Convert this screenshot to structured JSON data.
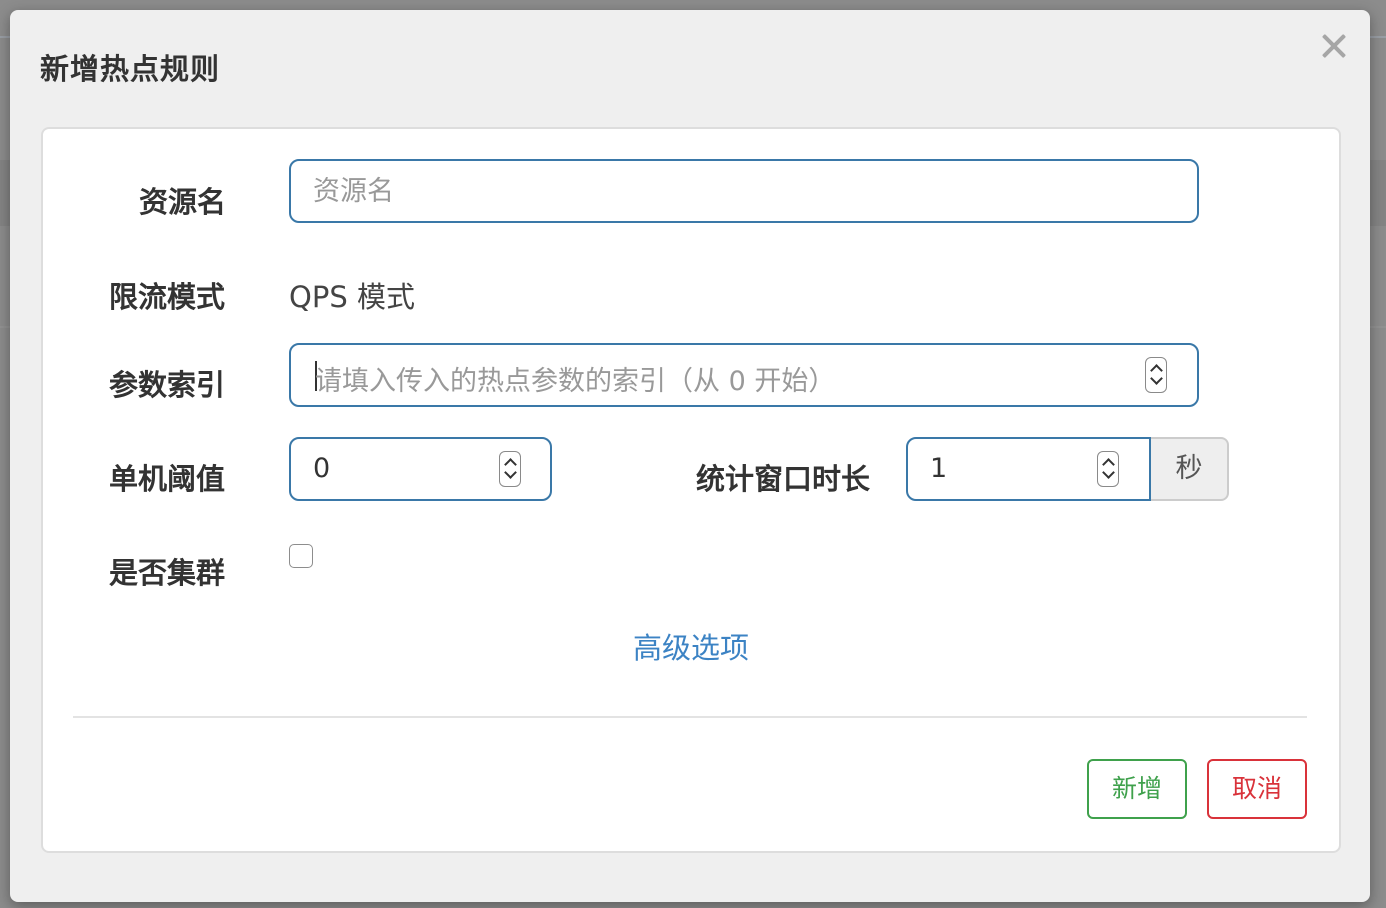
{
  "dialog": {
    "title": "新增热点规则"
  },
  "form": {
    "resource": {
      "label": "资源名",
      "placeholder": "资源名"
    },
    "mode": {
      "label": "限流模式",
      "value": "QPS 模式"
    },
    "param_index": {
      "label": "参数索引",
      "placeholder": "请填入传入的热点参数的索引（从 0 开始）"
    },
    "threshold": {
      "label": "单机阈值",
      "value": "0"
    },
    "window": {
      "label": "统计窗口时长",
      "value": "1",
      "unit": "秒"
    },
    "cluster": {
      "label": "是否集群",
      "checked": false
    },
    "advanced_link": "高级选项"
  },
  "footer": {
    "add_label": "新增",
    "cancel_label": "取消"
  },
  "colors": {
    "input_border": "#3a78a8",
    "link": "#3c83c4",
    "add_button": "#3fa14c",
    "cancel_button": "#d9323a"
  },
  "icons": {
    "close": "close-icon",
    "spinner": "spinner-icon"
  }
}
